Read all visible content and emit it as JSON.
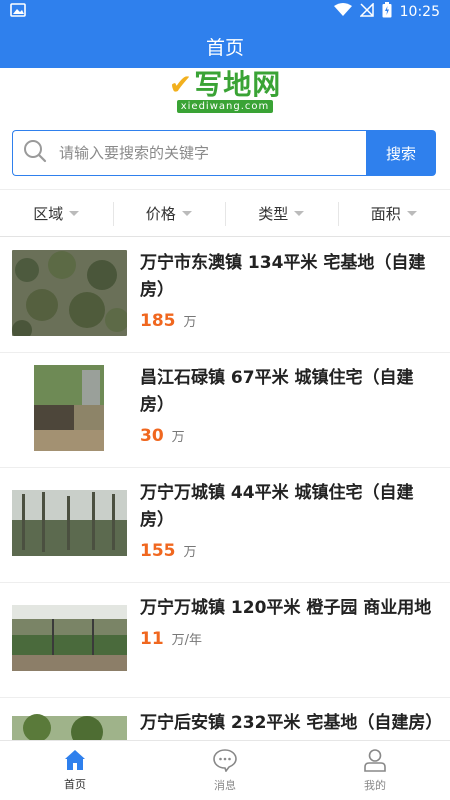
{
  "status_bar": {
    "time": "10:25"
  },
  "header": {
    "title": "首页"
  },
  "logo": {
    "main": "写地网",
    "sub": "xiediwang.com"
  },
  "search": {
    "placeholder": "请输入要搜索的关键字",
    "button_label": "搜索"
  },
  "filters": [
    {
      "label": "区域"
    },
    {
      "label": "价格"
    },
    {
      "label": "类型"
    },
    {
      "label": "面积"
    }
  ],
  "listings": [
    {
      "title": "万宁市东澳镇 134平米 宅基地（自建房）",
      "price": "185",
      "unit": "万"
    },
    {
      "title": "昌江石碌镇 67平米 城镇住宅（自建房）",
      "price": "30",
      "unit": "万"
    },
    {
      "title": "万宁万城镇 44平米 城镇住宅（自建房）",
      "price": "155",
      "unit": "万"
    },
    {
      "title": "万宁万城镇 120平米 橙子园 商业用地",
      "price": "11",
      "unit": "万/年"
    },
    {
      "title": "万宁后安镇 232平米 宅基地（自建房）",
      "price": "",
      "unit": ""
    }
  ],
  "tabbar": [
    {
      "label": "首页",
      "icon": "home-icon",
      "active": true
    },
    {
      "label": "消息",
      "icon": "chat-icon",
      "active": false
    },
    {
      "label": "我的",
      "icon": "user-icon",
      "active": false
    }
  ],
  "colors": {
    "primary": "#2f80ed",
    "price": "#f0671f",
    "logo_green": "#3aa335"
  }
}
